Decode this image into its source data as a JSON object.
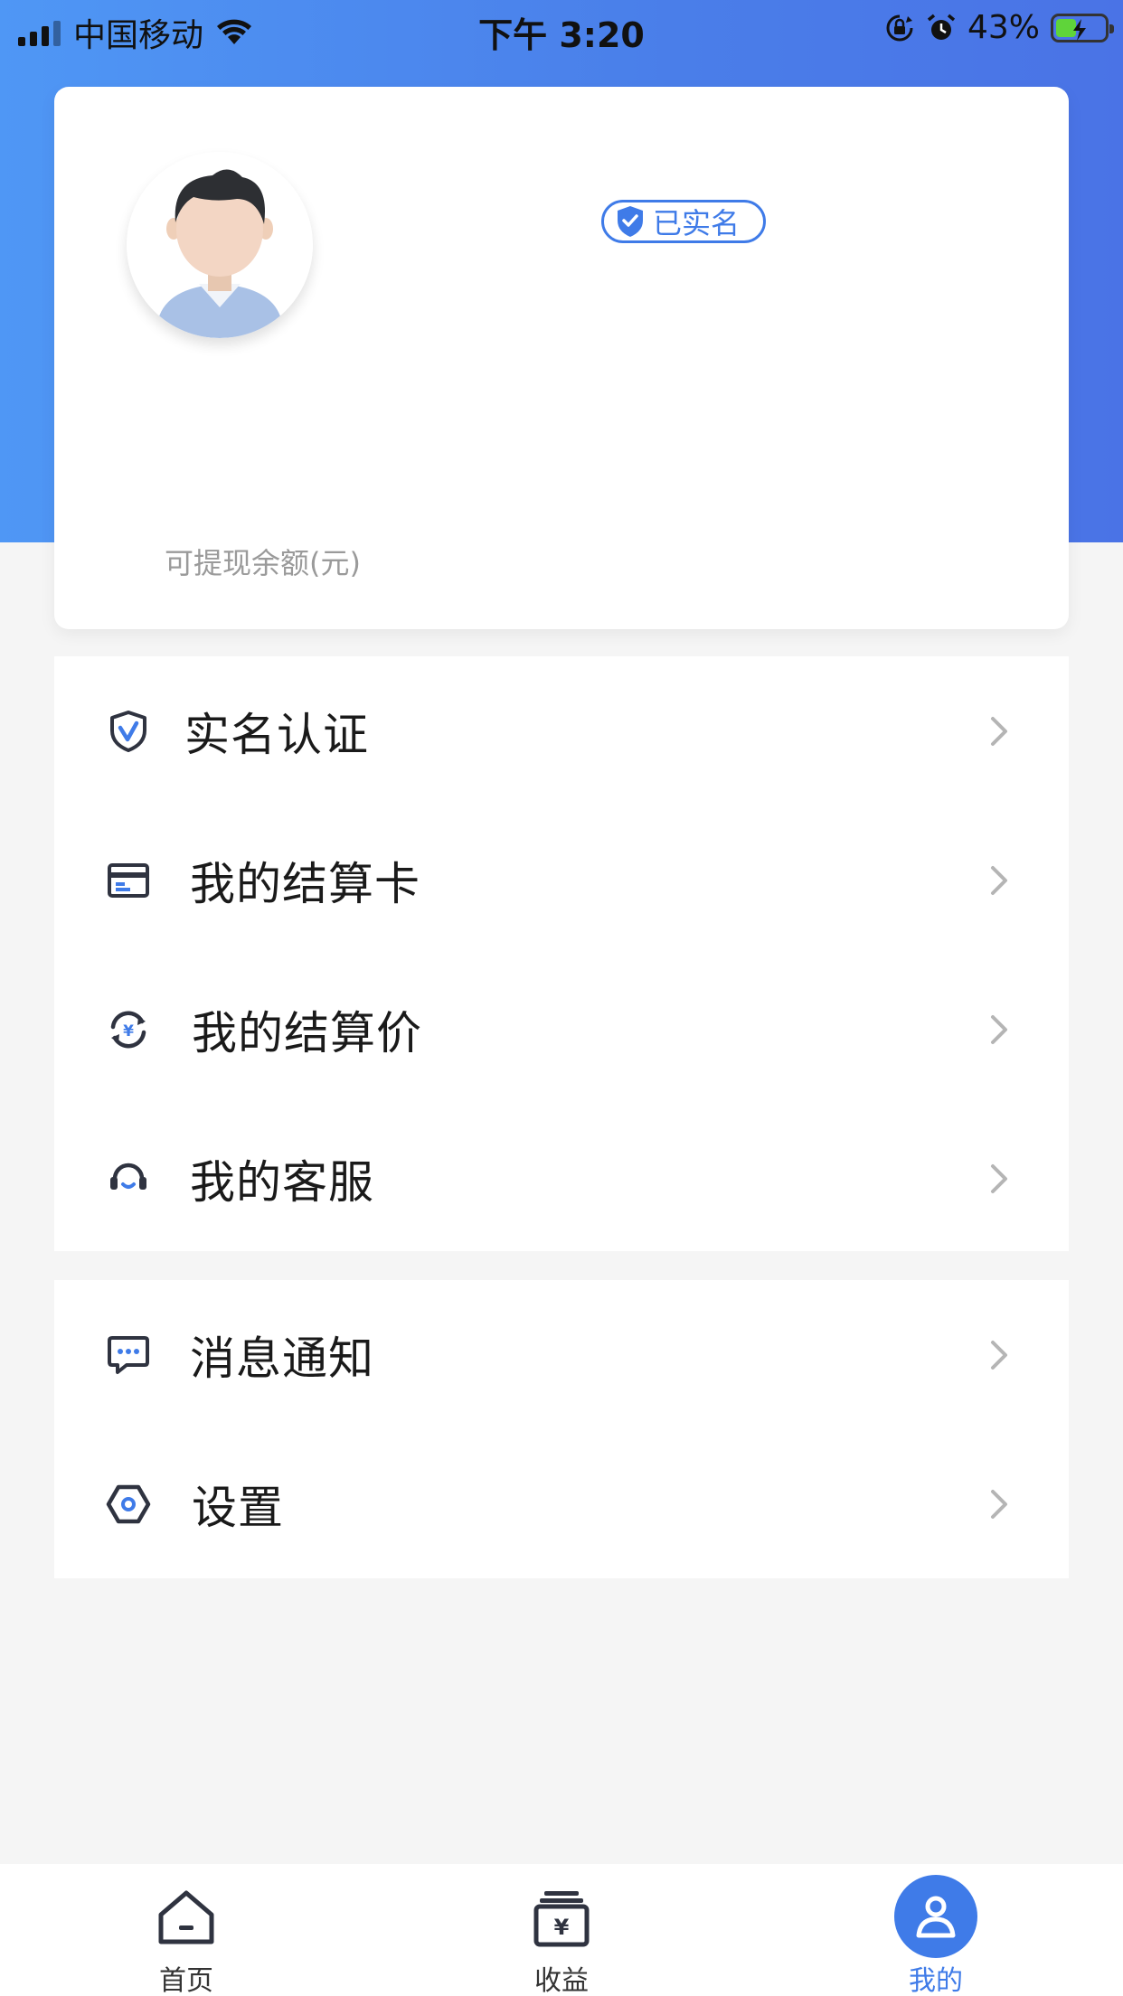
{
  "status_bar": {
    "carrier": "中国移动",
    "time": "下午 3:20",
    "battery_percent": "43%",
    "battery_level": 0.43
  },
  "profile": {
    "verified_badge": "已实名",
    "balance_label": "可提现余额(元)"
  },
  "menu_group_1": [
    {
      "label": "实名认证",
      "icon": "shield-check-icon"
    },
    {
      "label": "我的结算卡",
      "icon": "bank-card-icon"
    },
    {
      "label": "我的结算价",
      "icon": "yuan-refresh-icon"
    },
    {
      "label": "我的客服",
      "icon": "headset-icon"
    }
  ],
  "menu_group_2": [
    {
      "label": "消息通知",
      "icon": "message-icon"
    },
    {
      "label": "设置",
      "icon": "hexagon-settings-icon"
    }
  ],
  "tab_bar": {
    "tabs": [
      {
        "label": "首页",
        "icon": "home-icon",
        "active": false
      },
      {
        "label": "收益",
        "icon": "wallet-yuan-icon",
        "active": false
      },
      {
        "label": "我的",
        "icon": "user-icon",
        "active": true
      }
    ]
  },
  "colors": {
    "accent": "#3f7be8",
    "hero_gradient_start": "#4f97f5",
    "hero_gradient_end": "#4a73e6",
    "background": "#f5f5f5"
  }
}
